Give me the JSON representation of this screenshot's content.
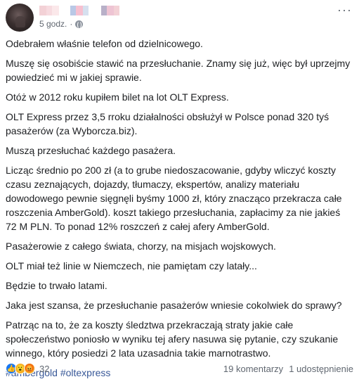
{
  "post": {
    "author_colors": [
      "#f3d1d6",
      "#b9c8e6",
      "#f6c0d0",
      "#d6e0ef",
      "#b8b0c8",
      "#eec4d3"
    ],
    "timestamp": "5 godz.",
    "separator": "·",
    "privacy_icon": "globe-icon",
    "more_icon": "ellipsis-icon",
    "more_label": "···",
    "paragraphs": [
      "Odebrałem właśnie telefon od dzielnicowego.",
      "Muszę się osobiście stawić na przesłuchanie. Znamy się już, więc był uprzejmy powiedzieć mi w jakiej sprawie.",
      "Otóż w 2012 roku kupiłem bilet na lot OLT Express.",
      "OLT Express przez 3,5 rroku działalności obsłużył w Polsce ponad 320 tyś pasażerów (za Wyborcza.biz).",
      "Muszą przesłuchać każdego pasażera.",
      "Licząc średnio po 200 zł (a to grube niedoszacowanie, gdyby wliczyć koszty czasu zeznających, dojazdy, tłumaczy, ekspertów, analizy materiału dowodowego pewnie sięgnęli byśmy 1000 zł, który znacząco przekracza całe roszczenia AmberGold). koszt takiego przesłuchania, zapłacimy za nie jakieś 72 M PLN. To ponad 12% roszczeń z całej afery AmberGold.",
      "Pasażerowie z całego świata, chorzy, na misjach wojskowych.",
      "OLT miał też linie w Niemczech, nie pamiętam czy latały...",
      "Będzie to trwało latami.",
      "Jaka jest szansa, że przesłuchanie pasażerów wniesie cokolwiek do sprawy?",
      "Patrząc na to, że za koszty śledztwa przekraczają straty jakie całe społeczeństwo poniosło w wyniku tej afery nasuwa się pytanie, czy szukanie winnego, który posiedzi 2 lata uzasadnia takie marnotrastwo."
    ],
    "hashtags": [
      "#ambergold",
      "#oltexpress"
    ]
  },
  "footer": {
    "reactions": [
      "like-icon",
      "wow-icon",
      "angry-icon"
    ],
    "reaction_count": "32",
    "comments": "19 komentarzy",
    "shares": "1 udostępnienie"
  }
}
